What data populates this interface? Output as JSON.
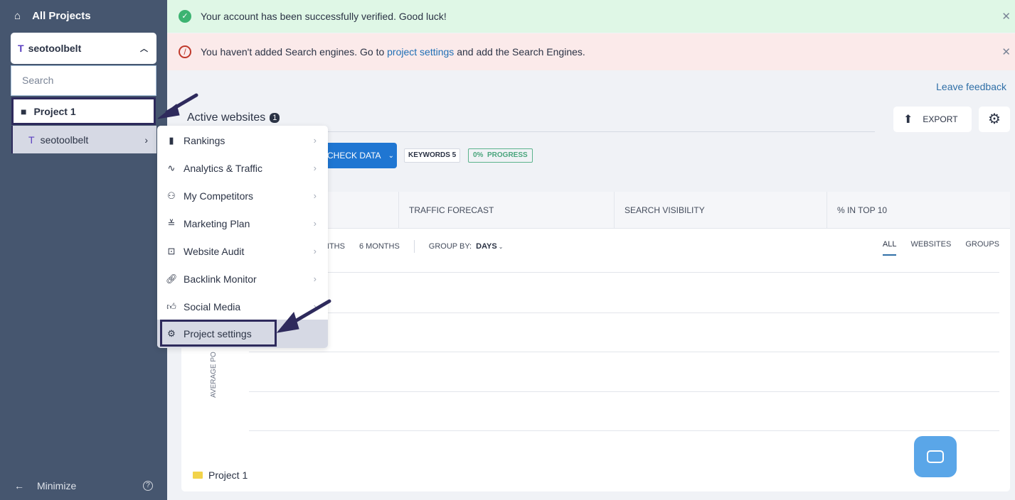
{
  "sidebar": {
    "all_projects": "All Projects",
    "project_select": "seotoolbelt",
    "search_placeholder": "Search",
    "folder": "Project 1",
    "site": "seotoolbelt",
    "minimize": "Minimize"
  },
  "banners": {
    "success": "Your account has been successfully verified. Good luck!",
    "error_prefix": "You haven't added Search engines. Go to ",
    "error_link": "project settings",
    "error_suffix": " and add the Search Engines."
  },
  "header": {
    "leave_feedback": "Leave feedback",
    "active_websites": "Active websites",
    "active_count": "1",
    "export": "EXPORT"
  },
  "toolbar": {
    "check_data": "CHECK DATA",
    "keywords": "KEYWORDS 5",
    "progress": "0%  PROGRESS",
    "progress_value": 0
  },
  "tabs": [
    "TRAFFIC FORECAST",
    "SEARCH VISIBILITY",
    "% IN TOP 10"
  ],
  "filters": {
    "months_partial": "NTHS",
    "six_months": "6 MONTHS",
    "group_by": "GROUP BY:",
    "group_value": "DAYS",
    "view": [
      "ALL",
      "WEBSITES",
      "GROUPS"
    ],
    "active_view": "ALL"
  },
  "chart": {
    "ylabel": "AVERAGE PO"
  },
  "footer_folder": "Project 1",
  "context_menu": [
    "Rankings",
    "Analytics & Traffic",
    "My Competitors",
    "Marketing Plan",
    "Website Audit",
    "Backlink Monitor",
    "Social Media",
    "Project settings"
  ],
  "colors": {
    "sidebar": "#46566f",
    "accent": "#1f76d2",
    "success_bg": "#dff7e6",
    "error_bg": "#fbeaea",
    "annotation": "#2e2a5c"
  }
}
